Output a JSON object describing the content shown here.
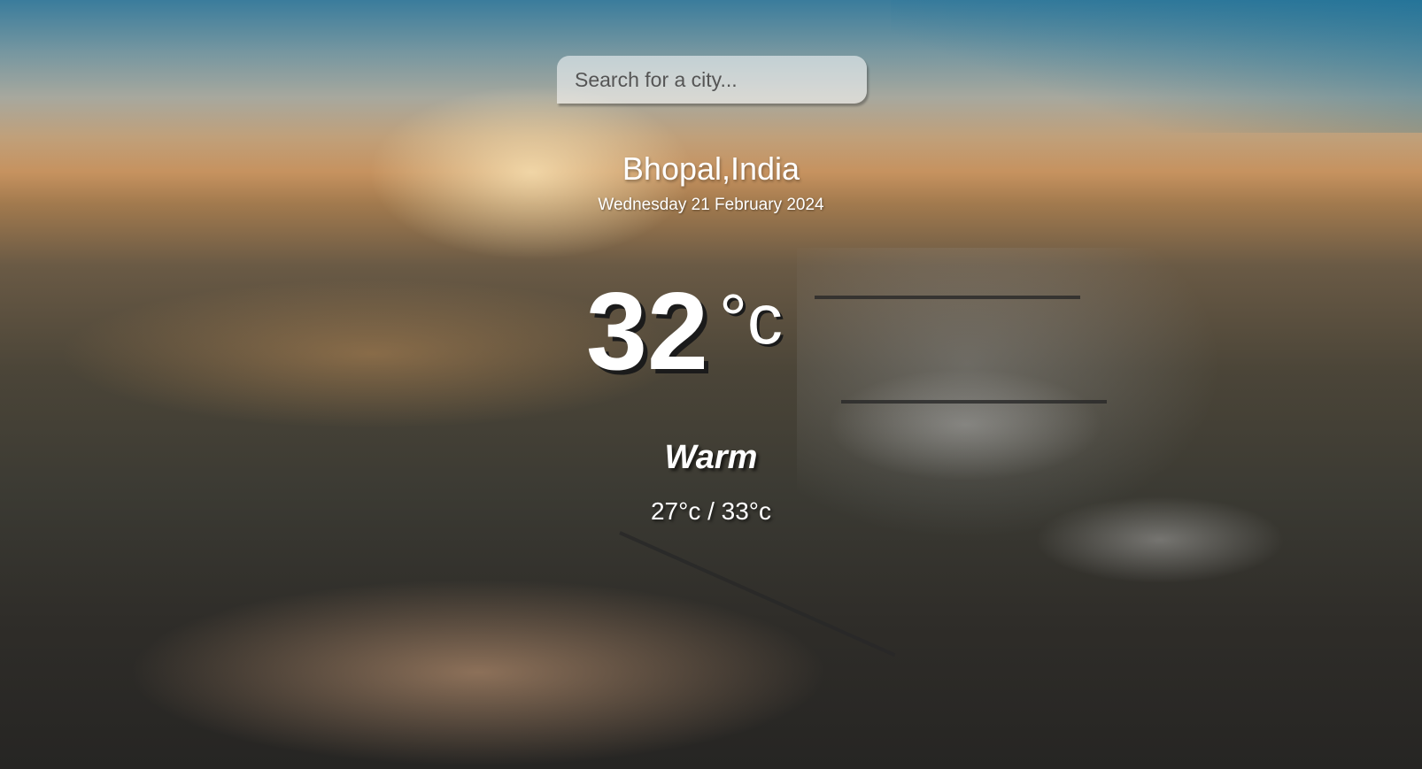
{
  "search": {
    "placeholder": "Search for a city..."
  },
  "location": {
    "city": "Bhopal,India",
    "date": "Wednesday 21 February 2024"
  },
  "weather": {
    "temperature": "32",
    "unit": "°c",
    "condition": "Warm",
    "range": "27°c / 33°c"
  }
}
